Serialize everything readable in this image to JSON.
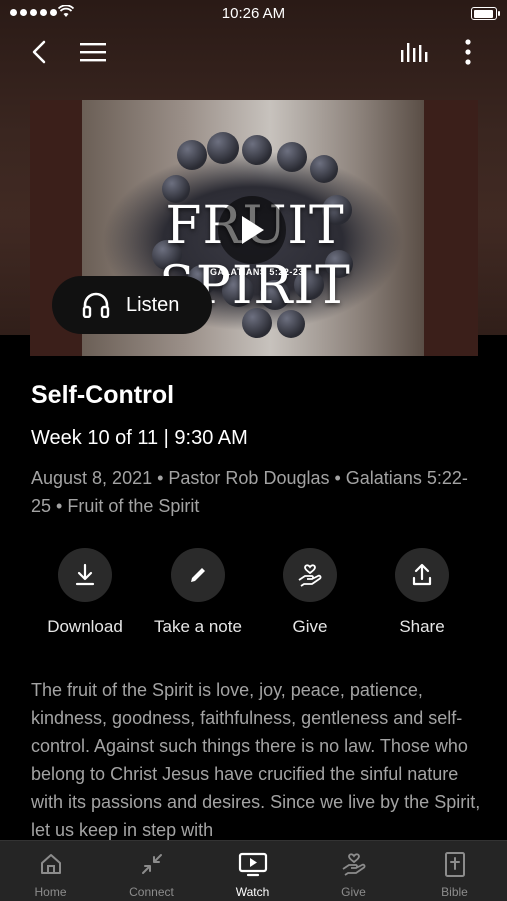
{
  "status_bar": {
    "time": "10:26 AM"
  },
  "nav": {
    "back_icon": "chevron-left-icon",
    "menu_icon": "hamburger-menu-icon",
    "audio_icon": "audio-levels-icon",
    "more_icon": "more-vertical-icon"
  },
  "video": {
    "title_art": "FRUIT SPIRIT",
    "reference_art": "GALATIANS 5:22-23",
    "listen_label": "Listen"
  },
  "sermon": {
    "title": "Self-Control",
    "subtitle": "Week 10 of 11 | 9:30 AM",
    "meta": "August 8, 2021 • Pastor Rob Douglas • Galatians 5:22-25 • Fruit of the Spirit",
    "description": "The fruit of the Spirit is love, joy, peace, patience, kindness, goodness, faithfulness, gentleness and self-control. Against such things there is no law. Those who belong to Christ Jesus have crucified the sinful nature with its passions and desires. Since we live by the Spirit, let us keep in step with"
  },
  "actions": [
    {
      "label": "Download",
      "icon": "download-icon"
    },
    {
      "label": "Take a note",
      "icon": "pencil-icon"
    },
    {
      "label": "Give",
      "icon": "giving-hand-icon"
    },
    {
      "label": "Share",
      "icon": "share-icon"
    }
  ],
  "tabs": [
    {
      "label": "Home",
      "icon": "home-icon",
      "active": false
    },
    {
      "label": "Connect",
      "icon": "connect-icon",
      "active": false
    },
    {
      "label": "Watch",
      "icon": "watch-icon",
      "active": true
    },
    {
      "label": "Give",
      "icon": "give-icon",
      "active": false
    },
    {
      "label": "Bible",
      "icon": "bible-icon",
      "active": false
    }
  ],
  "colors": {
    "background": "#000000",
    "tabbar": "#252525",
    "muted_text": "#a3a3a3"
  }
}
